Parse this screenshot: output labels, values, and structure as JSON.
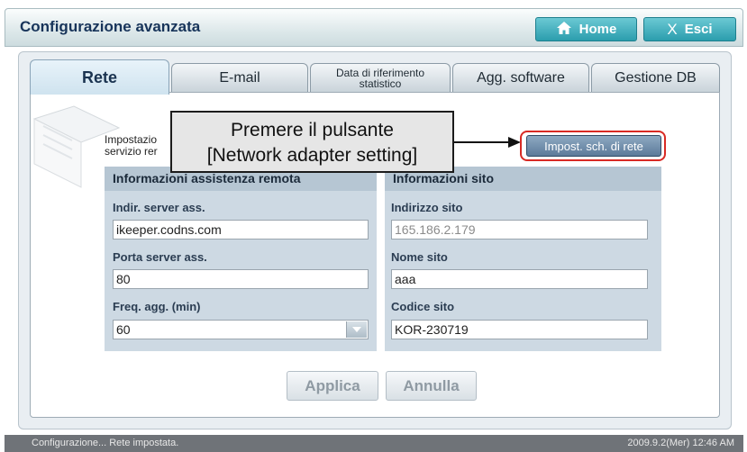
{
  "header": {
    "title": "Configurazione avanzata",
    "home_label": "Home",
    "exit_label": "Esci",
    "exit_icon": "X"
  },
  "tabs": [
    {
      "label": "Rete",
      "active": true
    },
    {
      "label": "E-mail"
    },
    {
      "label": "Data di riferimento statistico"
    },
    {
      "label": "Agg. software"
    },
    {
      "label": "Gestione DB"
    }
  ],
  "settings": {
    "label_line1": "Impostazio",
    "label_line2": "servizio rer",
    "adapter_button": "Impost. sch. di rete"
  },
  "remote": {
    "header": "Informazioni assistenza remota",
    "server_label": "Indir. server ass.",
    "server_value": "ikeeper.codns.com",
    "port_label": "Porta server ass.",
    "port_value": "80",
    "freq_label": "Freq. agg. (min)",
    "freq_value": "60"
  },
  "site": {
    "header": "Informazioni sito",
    "address_label": "Indirizzo sito",
    "address_value": "165.186.2.179",
    "name_label": "Nome sito",
    "name_value": "aaa",
    "code_label": "Codice sito",
    "code_value": "KOR-230719"
  },
  "actions": {
    "apply": "Applica",
    "cancel": "Annulla"
  },
  "callout": {
    "line1": "Premere il pulsante",
    "line2": "[Network adapter setting]"
  },
  "status": {
    "left": "Configurazione... Rete impostata.",
    "right": "2009.9.2(Mer)  12:46 AM"
  },
  "colors": {
    "accent": "#2b9dad",
    "highlight": "#d82a24"
  }
}
